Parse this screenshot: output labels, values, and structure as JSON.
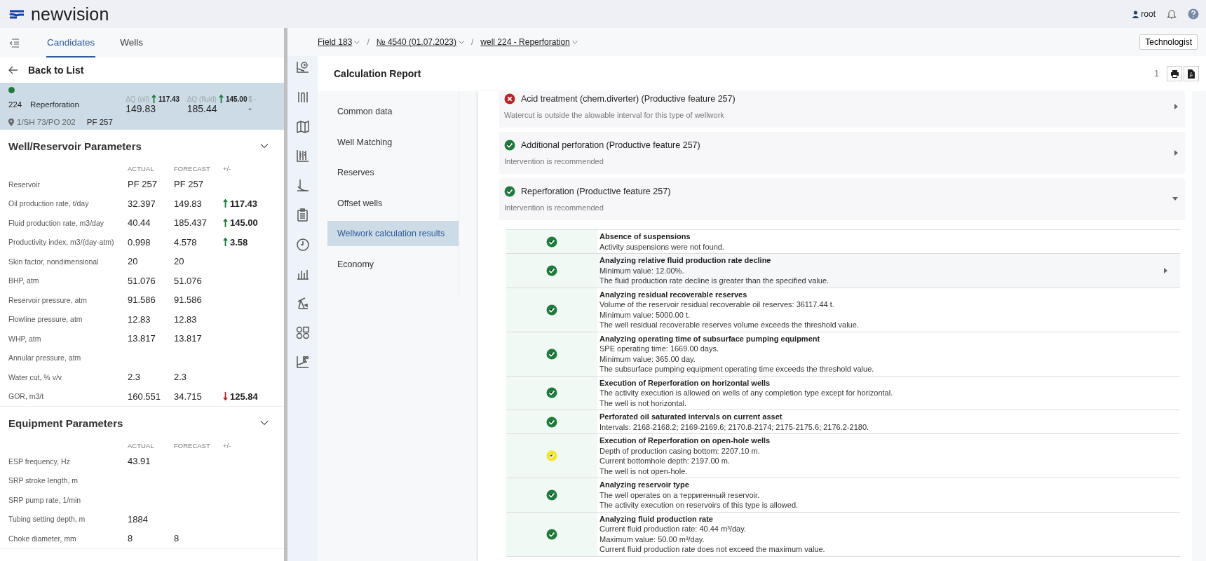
{
  "header": {
    "logo": "newvision",
    "user": "root"
  },
  "left_panel": {
    "tabs": [
      {
        "label": "Candidates",
        "selected": true
      },
      {
        "label": "Wells",
        "selected": false
      }
    ],
    "back_label": "Back to List",
    "candidate": {
      "color": "#1e7b3c",
      "number": "224",
      "name": "Reperforation",
      "location": "1/SH 73/PO 202",
      "reservoir": "PF 257",
      "metrics": [
        {
          "label": "ΔQ (oil)",
          "kind": "increase",
          "delta": "117.43",
          "value": "149.83"
        },
        {
          "label": "ΔQ (fluid)",
          "kind": "increase",
          "delta": "145.00",
          "value": "185.44"
        },
        {
          "label": "$ -",
          "kind": "plain",
          "value": "-"
        }
      ]
    },
    "sections": [
      {
        "title": "Well/Reservoir Parameters",
        "expanded": true,
        "columns": [
          "ACTUAL",
          "FORECAST",
          "+/-"
        ],
        "rows": [
          {
            "label": "Reservoir",
            "actual": "PF 257",
            "forecast": "PF 257",
            "kind": "plain"
          },
          {
            "label": "Oil production rate, t/day",
            "actual": "32.397",
            "forecast": "149.83",
            "change": "117.43",
            "kind": "increase"
          },
          {
            "label": "Fluid production rate, m3/day",
            "actual": "40.44",
            "forecast": "185.437",
            "change": "145.00",
            "kind": "increase"
          },
          {
            "label": "Productivity index, m3/(day·atm)",
            "actual": "0.998",
            "forecast": "4.578",
            "change": "3.58",
            "kind": "increase"
          },
          {
            "label": "Skin factor, nondimensional",
            "actual": "20",
            "forecast": "20",
            "kind": "plain"
          },
          {
            "label": "BHP, atm",
            "actual": "51.076",
            "forecast": "51.076",
            "kind": "plain"
          },
          {
            "label": "Reservoir pressure, atm",
            "actual": "91.586",
            "forecast": "91.586",
            "kind": "plain"
          },
          {
            "label": "Flowline pressure, atm",
            "actual": "12.83",
            "forecast": "12.83",
            "kind": "plain"
          },
          {
            "label": "WHP, atm",
            "actual": "13.817",
            "forecast": "13.817",
            "kind": "plain"
          },
          {
            "label": "Annular pressure, atm",
            "kind": "plain"
          },
          {
            "label": "Water cut, % v/v",
            "actual": "2.3",
            "forecast": "2.3",
            "kind": "plain"
          },
          {
            "label": "GOR, m3/t",
            "actual": "160.551",
            "forecast": "34.715",
            "change": "125.84",
            "kind": "decrease"
          }
        ]
      },
      {
        "title": "Equipment Parameters",
        "expanded": true,
        "columns": [
          "ACTUAL",
          "FORECAST",
          "+/-"
        ],
        "rows": [
          {
            "label": "ESP frequency, Hz",
            "actual": "43.91",
            "kind": "plain"
          },
          {
            "label": "SRP stroke length, m",
            "kind": "plain"
          },
          {
            "label": "SRP pump rate, 1/min",
            "kind": "plain"
          },
          {
            "label": "Tubing setting depth, m",
            "actual": "1884",
            "kind": "plain"
          },
          {
            "label": "Choke diameter, mm",
            "actual": "8",
            "forecast": "8",
            "kind": "plain"
          }
        ]
      }
    ]
  },
  "breadcrumbs": [
    {
      "kind": "link",
      "label": "Field 183"
    },
    {
      "kind": "separator",
      "label": "/"
    },
    {
      "kind": "link",
      "label": "№ 4540 (01.07.2023)"
    },
    {
      "kind": "separator",
      "label": "/"
    },
    {
      "kind": "link",
      "label": "well 224 - Reperforation"
    }
  ],
  "role_button": "Technologist",
  "report": {
    "title": "Calculation Report",
    "page": "1",
    "nav": [
      {
        "label": "Common data",
        "selected": false
      },
      {
        "label": "Well Matching",
        "selected": false
      },
      {
        "label": "Reserves",
        "selected": false
      },
      {
        "label": "Offset wells",
        "selected": false
      },
      {
        "label": "Wellwork calculation results",
        "selected": true
      },
      {
        "label": "Economy",
        "selected": false
      }
    ],
    "results": [
      {
        "kind": "fail",
        "title": "Acid treatment (chem.diverter) (Productive feature 257)",
        "subtitle": "Watercut is outside the alowable interval for this type of wellwork",
        "expanded": false
      },
      {
        "kind": "pass",
        "title": "Additional perforation (Productive feature 257)",
        "subtitle": "Intervention is recommended",
        "expanded": false
      },
      {
        "kind": "pass",
        "title": "Reperforation (Productive feature 257)",
        "subtitle": "Intervention is recommended",
        "expanded": true
      }
    ],
    "checks": [
      {
        "kind": "pass",
        "expandable": false,
        "title": "Absence of suspensions",
        "lines": [
          "Activity suspensions were not found."
        ]
      },
      {
        "kind": "pass",
        "expandable": true,
        "title": "Analyzing relative fluid production rate decline",
        "lines": [
          "Minimum value: 12.00%.",
          "The fluid production rate decline is greater than the specified value."
        ]
      },
      {
        "kind": "pass",
        "expandable": false,
        "title": "Analyzing residual recoverable reserves",
        "lines": [
          "Volume of the reservoir residual recoverable oil reserves: 36117.44 t.",
          "Minimum value: 5000.00 t.",
          "The well residual recoverable reserves volume exceeds the threshold value."
        ]
      },
      {
        "kind": "pass",
        "expandable": false,
        "title": "Analyzing operating time of subsurface pumping equipment",
        "lines": [
          "SPE operating time: 1669.00 days.",
          "Minimum value: 365.00 day.",
          "The subsurface pumping equipment operating time exceeds the threshold value."
        ]
      },
      {
        "kind": "pass",
        "expandable": false,
        "title": "Execution of Reperforation on horizontal wells",
        "lines": [
          "The activity execution is allowed on wells of any completion type except for horizontal.",
          "The well is not horizontal."
        ]
      },
      {
        "kind": "pass",
        "expandable": false,
        "title": "Perforated oil saturated intervals on current asset",
        "lines": [
          "Intervals: 2168-2168.2; 2169-2169.6; 2170.8-2174; 2175-2175.6; 2176.2-2180."
        ]
      },
      {
        "kind": "warning",
        "expandable": false,
        "title": "Execution of Reperforation on open-hole wells",
        "lines": [
          "Depth of production casing bottom: 2207.10 m.",
          "Current bottomhole depth: 2197.00 m.",
          "The well is not open-hole."
        ]
      },
      {
        "kind": "pass",
        "expandable": false,
        "title": "Analyzing reservoir type",
        "lines": [
          "The well operates on a терригенный reservoir.",
          "The activity execution on reservoirs of this type is allowed."
        ]
      },
      {
        "kind": "pass",
        "expandable": false,
        "title": "Analyzing fluid production rate",
        "lines": [
          "Current fluid production rate: 40.44 m³/day.",
          "Maximum value: 50.00 m³/day.",
          "Current fluid production rate does not exceed the maximum value."
        ]
      }
    ]
  }
}
